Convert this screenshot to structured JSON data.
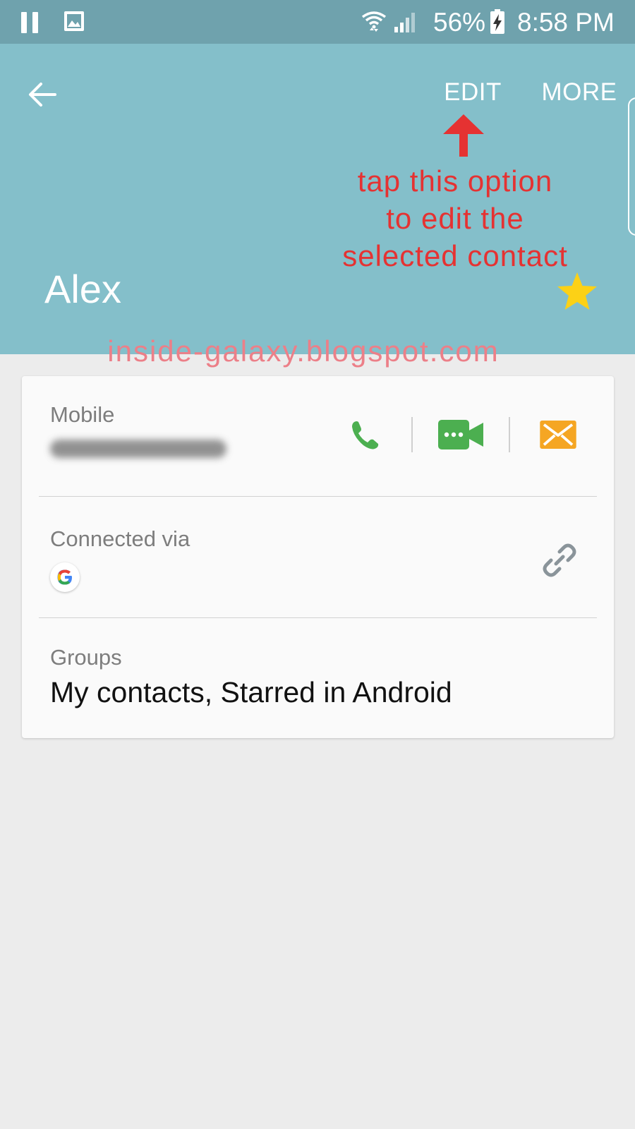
{
  "status_bar": {
    "battery_percent": "56%",
    "time": "8:58 PM",
    "icons": [
      "pause-icon",
      "image-icon",
      "wifi-icon",
      "signal-icon",
      "battery-charging-icon"
    ]
  },
  "header": {
    "back_icon": "arrow-left-icon",
    "edit_label": "EDIT",
    "more_label": "MORE",
    "contact_name": "Alex",
    "star_icon": "star-icon",
    "background_color": "#84bfca"
  },
  "annotation": {
    "lines": [
      "tap this option",
      "to edit the",
      "selected contact"
    ],
    "color": "#e53232"
  },
  "watermark": "inside-galaxy.blogspot.com",
  "card": {
    "mobile": {
      "label": "Mobile",
      "actions": [
        {
          "name": "call",
          "icon": "phone-icon",
          "color": "#4caf50"
        },
        {
          "name": "video-call",
          "icon": "video-call-icon",
          "color": "#4caf50"
        },
        {
          "name": "message",
          "icon": "message-icon",
          "color": "#f5a623"
        }
      ]
    },
    "connected_via": {
      "label": "Connected via",
      "account_icon": "google-icon",
      "link_icon": "link-icon"
    },
    "groups": {
      "label": "Groups",
      "value": "My contacts, Starred in Android"
    }
  }
}
